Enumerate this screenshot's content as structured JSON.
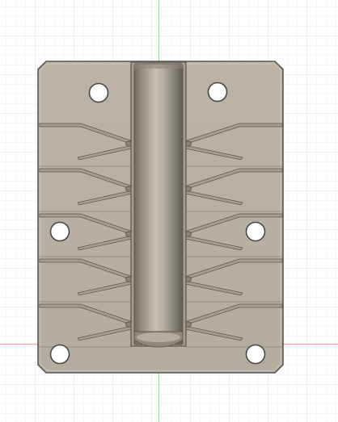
{
  "canvas": {
    "background": "#ffffff",
    "grid_major": "#eef0f2",
    "grid_minor": "#f6f7f8",
    "axis_green": "#9fd99f",
    "axis_red": "#ef9a9a"
  },
  "model": {
    "plate_color": "#b7b0a3",
    "plate_edge": "#5b5750",
    "channel_color": "#a59e91",
    "hole_color": "#ffffff",
    "rod_dark": "#6f6a62",
    "rod_light": "#c9c3b8",
    "cavity_count_per_side": 5,
    "mounting_holes": 6
  }
}
